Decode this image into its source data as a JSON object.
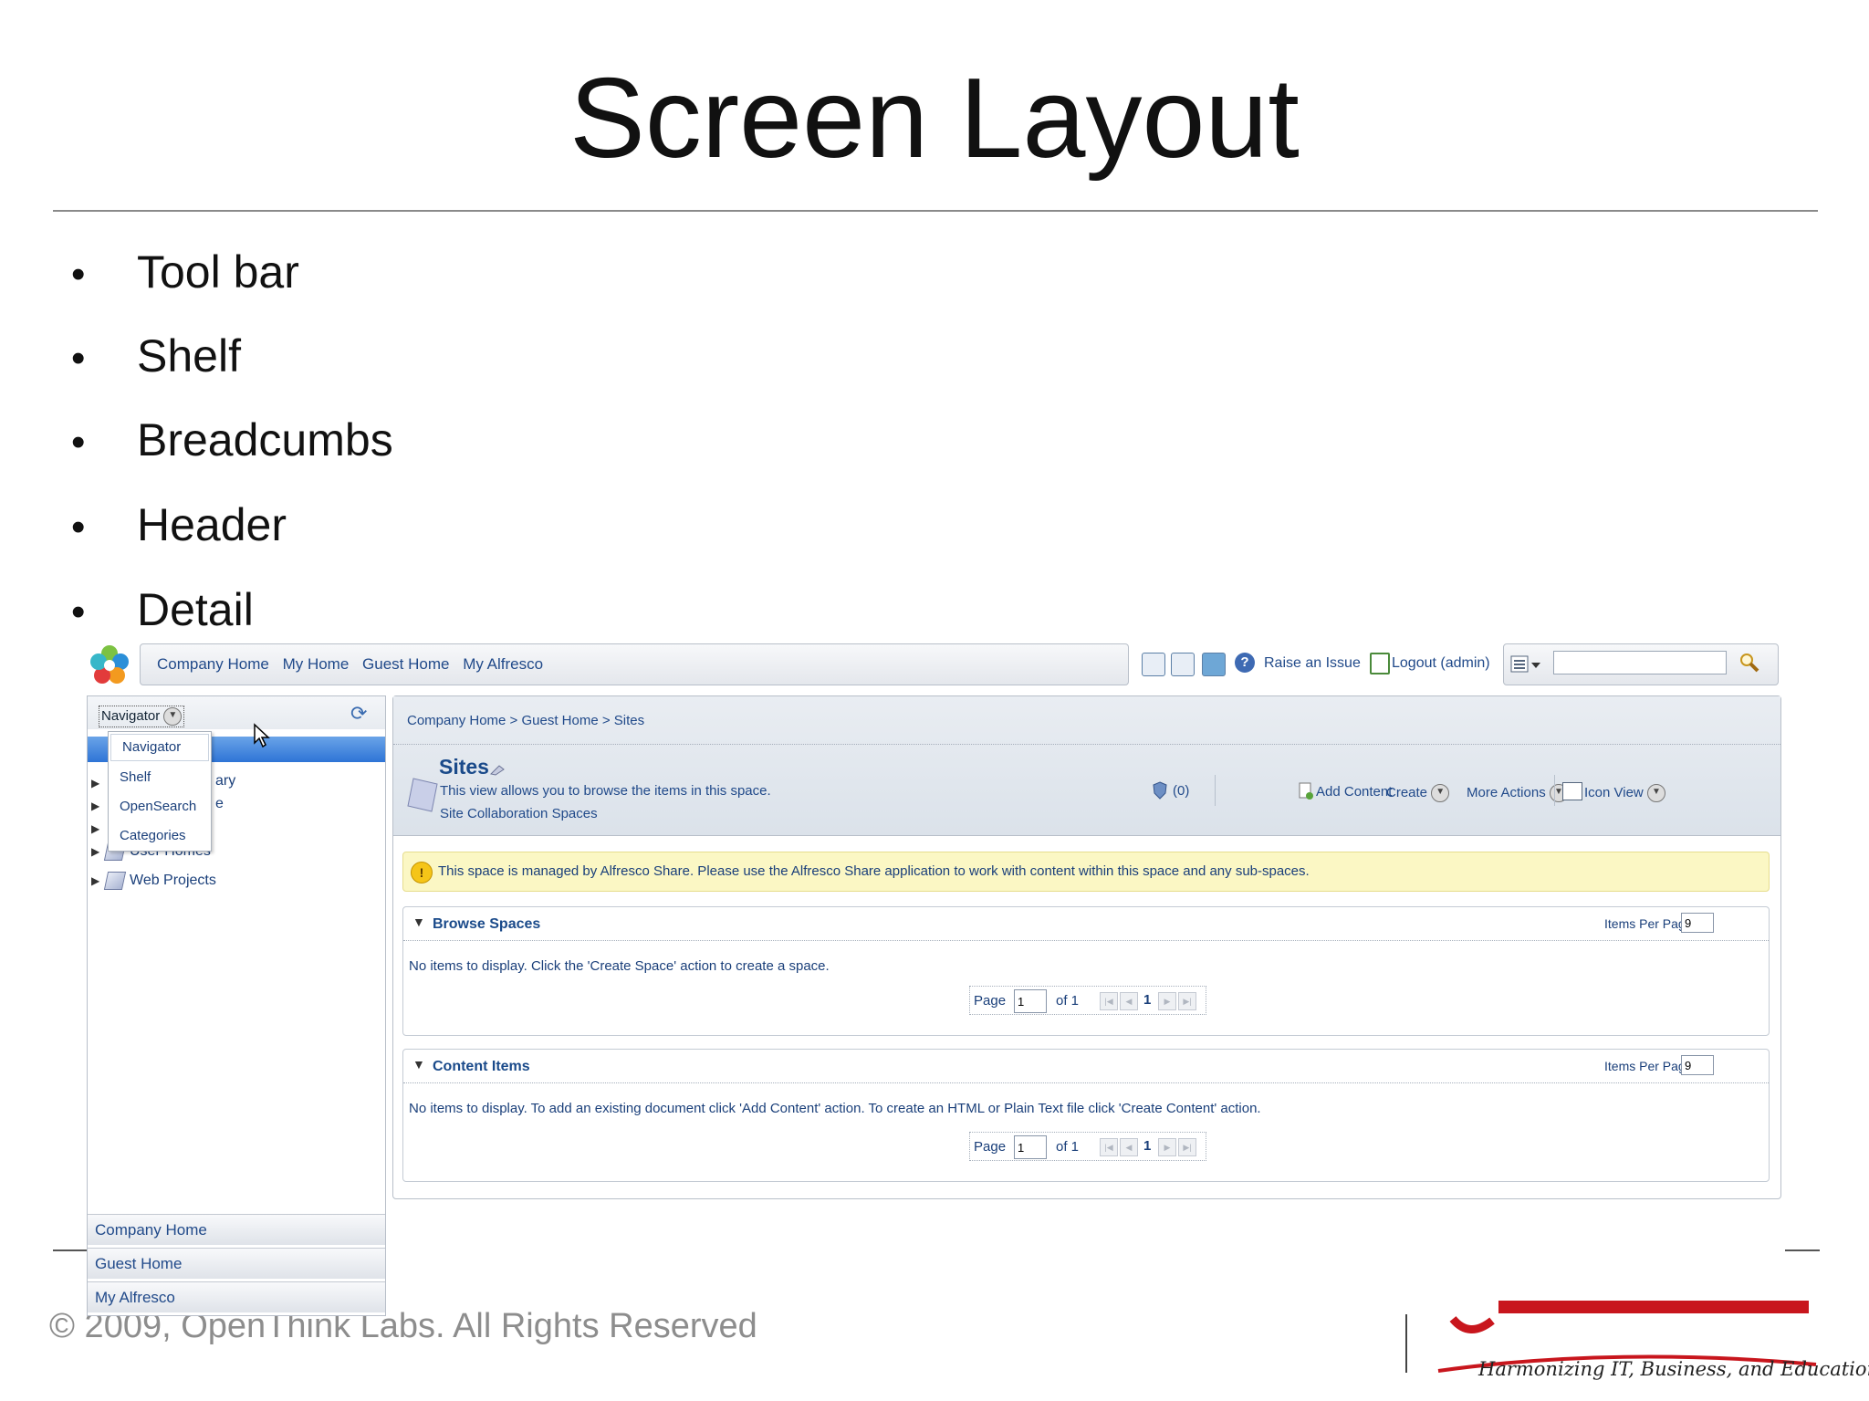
{
  "slide": {
    "title": "Screen Layout",
    "bullets": [
      "Tool bar",
      "Shelf",
      "Breadcumbs",
      "Header",
      "Detail"
    ],
    "copyright": "© 2009, OpenThink Labs. All Rights Reserved",
    "logo_tagline": "Harmonizing IT, Business, and Education",
    "logo_color": "#c8161d"
  },
  "app": {
    "toolbar_links": [
      "Company Home",
      "My Home",
      "Guest Home",
      "My Alfresco"
    ],
    "raise_issue": "Raise an Issue",
    "logout": "Logout (admin)",
    "search_placeholder": "",
    "navigator": {
      "selector_label": "Navigator",
      "dropdown": [
        "Navigator",
        "Shelf",
        "OpenSearch",
        "Categories"
      ],
      "partial_text_1": "ary",
      "partial_text_2": "e",
      "tree": [
        "User Homes",
        "Web Projects"
      ],
      "bottom_tabs": [
        "Company Home",
        "Guest Home",
        "My Alfresco"
      ]
    },
    "main": {
      "breadcrumb": "Company Home > Guest Home > Sites",
      "title": "Sites",
      "description": "This view allows you to browse the items in this space.",
      "subtitle": "Site Collaboration Spaces",
      "count": "(0)",
      "actions": {
        "add_content": "Add Content",
        "create": "Create",
        "more_actions": "More Actions",
        "icon_view": "Icon View"
      },
      "notice": "This space is managed by Alfresco Share. Please use the Alfresco Share application to work with content within this space and any sub-spaces.",
      "browse_spaces": {
        "title": "Browse Spaces",
        "items_per_page_label": "Items Per Page",
        "items_per_page": "9",
        "message": "No items to display. Click the 'Create Space' action to create a space.",
        "page_label": "Page",
        "page_value": "1",
        "of_label": "of 1",
        "current_page": "1"
      },
      "content_items": {
        "title": "Content Items",
        "items_per_page_label": "Items Per Page",
        "items_per_page": "9",
        "message": "No items to display. To add an existing document click 'Add Content' action. To create an HTML or Plain Text file click 'Create Content' action.",
        "page_label": "Page",
        "page_value": "1",
        "of_label": "of 1",
        "current_page": "1"
      }
    }
  }
}
